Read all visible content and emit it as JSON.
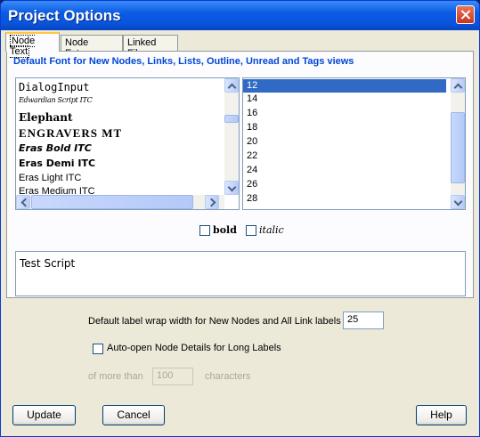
{
  "window": {
    "title": "Project Options"
  },
  "tabs": [
    {
      "label": "Node Text"
    },
    {
      "label": "Node Extras"
    },
    {
      "label": "Linked Files"
    }
  ],
  "group": {
    "title": "Default Font for New Nodes, Links, Lists, Outline, Unread and Tags views"
  },
  "fonts": [
    {
      "name": "DialogInput",
      "style": "dialoginput"
    },
    {
      "name": "Edwardian Script ITC",
      "style": "script"
    },
    {
      "name": "Elephant",
      "style": "elephant"
    },
    {
      "name": "ENGRAVERS MT",
      "style": "engravers"
    },
    {
      "name": "Eras Bold ITC",
      "style": "eras-bold"
    },
    {
      "name": "Eras Demi ITC",
      "style": "eras-demi"
    },
    {
      "name": "Eras Light ITC",
      "style": "eras-light"
    },
    {
      "name": "Eras Medium ITC",
      "style": "eras-medium"
    }
  ],
  "sizes": [
    "12",
    "14",
    "16",
    "18",
    "20",
    "22",
    "24",
    "26",
    "28"
  ],
  "selected_size": "12",
  "options": {
    "bold_label": "bold",
    "italic_label": "italic",
    "bold_checked": false,
    "italic_checked": false
  },
  "preview_text": "Test Script",
  "wrap": {
    "label": "Default label wrap width for New Nodes and All Link labels",
    "value": "25"
  },
  "auto_open": {
    "label": "Auto-open Node Details for Long Labels",
    "checked": false,
    "prefix": "of more than",
    "value": "100",
    "suffix": "characters"
  },
  "buttons": {
    "update": "Update",
    "cancel": "Cancel",
    "help": "Help"
  },
  "icons": {
    "close": "close-icon",
    "scroll_up": "chevron-up-icon",
    "scroll_down": "chevron-down-icon",
    "scroll_left": "chevron-left-icon",
    "scroll_right": "chevron-right-icon"
  },
  "colors": {
    "titlebar": "#0b5ce5",
    "group_title": "#0046d5",
    "selection": "#316ac5",
    "tab_highlight": "#ffc83c"
  }
}
